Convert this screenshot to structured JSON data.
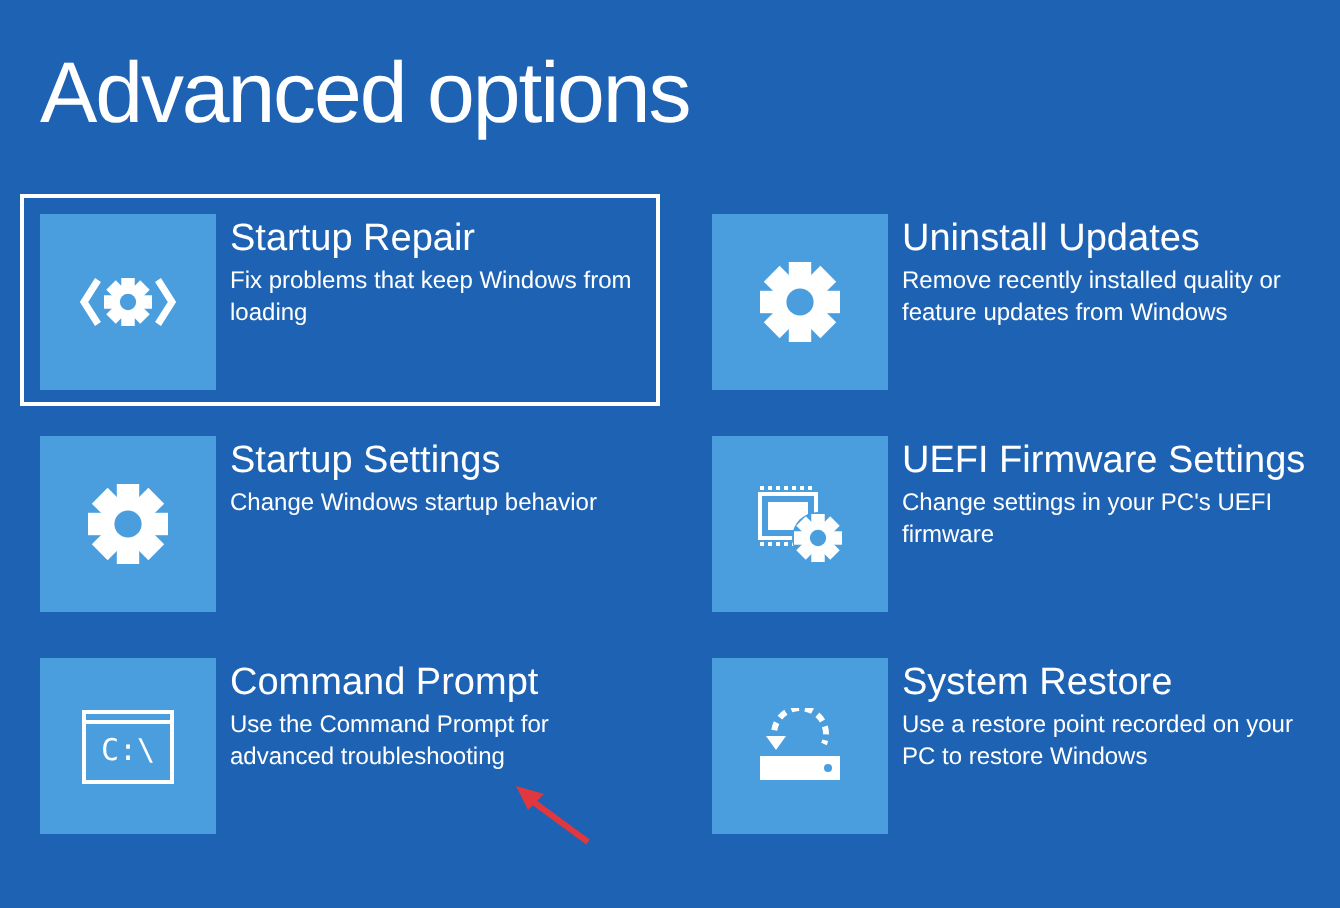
{
  "title": "Advanced options",
  "options": [
    {
      "kind": "repair",
      "title": "Startup Repair",
      "description": "Fix problems that keep Windows from loading",
      "selected": true,
      "annotated": false
    },
    {
      "kind": "gear",
      "title": "Uninstall Updates",
      "description": "Remove recently installed quality or feature updates from Windows",
      "selected": false,
      "annotated": false
    },
    {
      "kind": "gear",
      "title": "Startup Settings",
      "description": "Change Windows startup behavior",
      "selected": false,
      "annotated": false
    },
    {
      "kind": "chip",
      "title": "UEFI Firmware Settings",
      "description": "Change settings in your PC's UEFI firmware",
      "selected": false,
      "annotated": false
    },
    {
      "kind": "terminal",
      "title": "Command Prompt",
      "description": "Use the Command Prompt for advanced troubleshooting",
      "icon_text": "C:\\",
      "selected": false,
      "annotated": true
    },
    {
      "kind": "restore",
      "title": "System Restore",
      "description": "Use a restore point recorded on your PC to restore Windows",
      "selected": false,
      "annotated": false
    }
  ]
}
